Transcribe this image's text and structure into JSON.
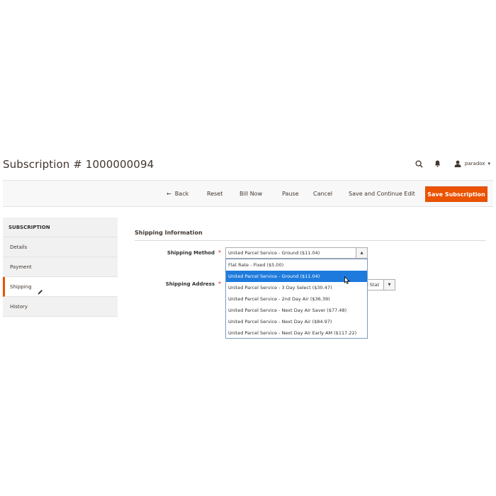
{
  "page": {
    "title": "Subscription # 1000000094"
  },
  "header": {
    "search_icon": "search-icon",
    "bell_icon": "bell-icon",
    "user_icon": "user-icon",
    "username": "paradox"
  },
  "actions": {
    "back": "Back",
    "back_arrow": "←",
    "reset": "Reset",
    "bill_now": "Bill Now",
    "pause": "Pause",
    "cancel": "Cancel",
    "save_continue": "Save and Continue Edit",
    "save": "Save Subscription",
    "save_color": "#eb5202"
  },
  "sidebar": {
    "header": "SUBSCRIPTION",
    "items": [
      {
        "label": "Details"
      },
      {
        "label": "Payment"
      },
      {
        "label": "Shipping"
      },
      {
        "label": "History"
      }
    ],
    "active_index": 2
  },
  "form": {
    "section_title": "Shipping Information",
    "shipping_method": {
      "label": "Shipping Method",
      "required_mark": "*",
      "value": "United Parcel Service - Ground ($11.04)",
      "options": [
        "Flat Rate - Fixed ($5.00)",
        "United Parcel Service - Ground ($11.04)",
        "United Parcel Service - 3 Day Select ($30.47)",
        "United Parcel Service - 2nd Day Air ($36.39)",
        "United Parcel Service - Next Day Air Saver ($77.48)",
        "United Parcel Service - Next Day Air ($84.97)",
        "United Parcel Service - Next Day Air Early AM ($117.22)"
      ],
      "selected_index": 1,
      "highlight_color": "#1e7bdd"
    },
    "shipping_address": {
      "label": "Shipping Address",
      "required_mark": "*",
      "visible_value": "d Stat"
    }
  }
}
